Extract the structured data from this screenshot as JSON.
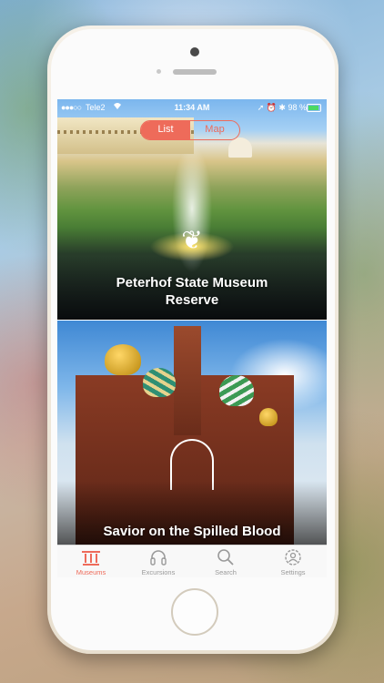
{
  "status_bar": {
    "signal": "●●●○○",
    "carrier": "Tele2",
    "time": "11:34 AM",
    "right": "➚ ⏰ ✱ 98 %"
  },
  "segmented": {
    "list": "List",
    "map": "Map",
    "selected": "List"
  },
  "cards": [
    {
      "title": "Peterhof State Museum Reserve"
    },
    {
      "title": "Savior on the Spilled Blood"
    }
  ],
  "tabbar": {
    "items": [
      {
        "label": "Museums",
        "icon": "museum-icon",
        "active": true
      },
      {
        "label": "Excursions",
        "icon": "headphones-icon",
        "active": false
      },
      {
        "label": "Search",
        "icon": "search-icon",
        "active": false
      },
      {
        "label": "Settings",
        "icon": "settings-icon",
        "active": false
      }
    ]
  },
  "colors": {
    "accent": "#ee6b5a",
    "inactive": "#9a9a9a"
  }
}
